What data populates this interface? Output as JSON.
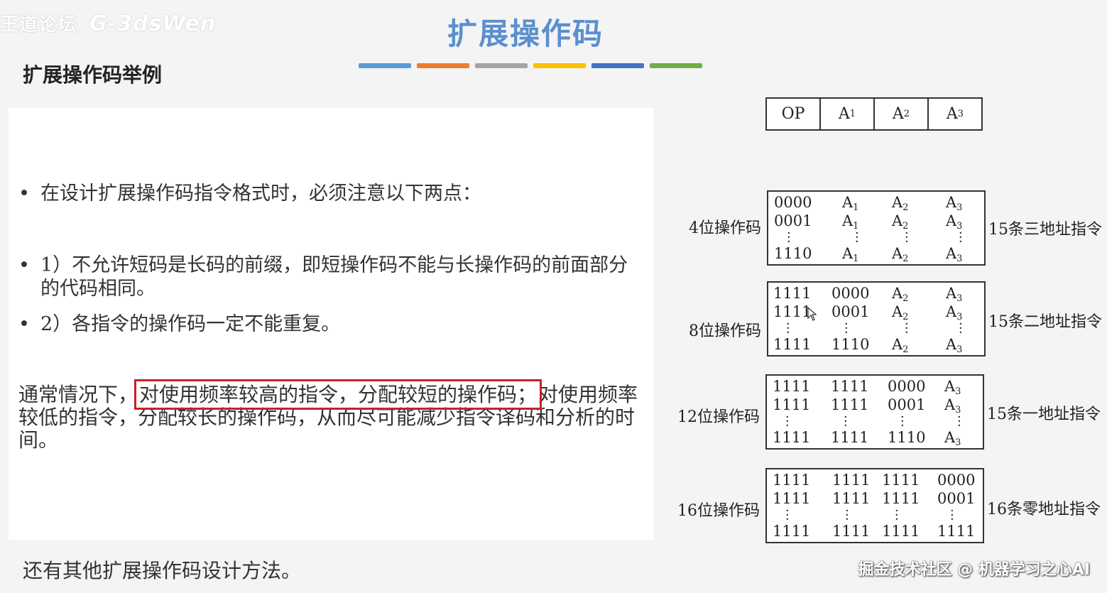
{
  "watermark": {
    "text": "王道论坛",
    "scribble": "G-3dsWen"
  },
  "title": "扩展操作码",
  "subtitle": "扩展操作码举例",
  "color_bar": [
    "#5b9bd5",
    "#ed7d31",
    "#a5a5a5",
    "#ffc000",
    "#4472c4",
    "#70ad47"
  ],
  "bullets": [
    "在设计扩展操作码指令格式时，必须注意以下两点：",
    "1）不允许短码是长码的前缀，即短操作码不能与长操作码的前面部分的代码相同。",
    "2）各指令的操作码一定不能重复。"
  ],
  "paragraph": {
    "before": "通常情况下，",
    "highlight": "对使用频率较高的指令，分配较短的操作码；",
    "after": "对使用频率较低的指令，分配较长的操作码，从而尽可能减少指令译码和分析的时间。"
  },
  "footer_note": "还有其他扩展操作码设计方法。",
  "brand": "掘金技术社区 @ 机器学习之心AI",
  "format": {
    "op": "OP",
    "a": "A",
    "subs": [
      "1",
      "2",
      "3"
    ]
  },
  "groups": [
    {
      "left": "4位操作码",
      "right": "15条三地址指令",
      "rows": [
        [
          "0000",
          "A1",
          "A2",
          "A3"
        ],
        [
          "0001",
          "A1",
          "A2",
          "A3"
        ],
        [
          "1110",
          "A1",
          "A2",
          "A3"
        ]
      ]
    },
    {
      "left": "8位操作码",
      "right": "15条二地址指令",
      "rows": [
        [
          "1111",
          "0000",
          "A2",
          "A3"
        ],
        [
          "1111",
          "0001",
          "A2",
          "A3"
        ],
        [
          "1111",
          "1110",
          "A2",
          "A3"
        ]
      ]
    },
    {
      "left": "12位操作码",
      "right": "15条一地址指令",
      "rows": [
        [
          "1111",
          "1111",
          "0000",
          "A3"
        ],
        [
          "1111",
          "1111",
          "0001",
          "A3"
        ],
        [
          "1111",
          "1111",
          "1110",
          "A3"
        ]
      ]
    },
    {
      "left": "16位操作码",
      "right": "16条零地址指令",
      "rows": [
        [
          "1111",
          "1111",
          "1111",
          "0000"
        ],
        [
          "1111",
          "1111",
          "1111",
          "0001"
        ],
        [
          "1111",
          "1111",
          "1111",
          "1111"
        ]
      ]
    }
  ]
}
